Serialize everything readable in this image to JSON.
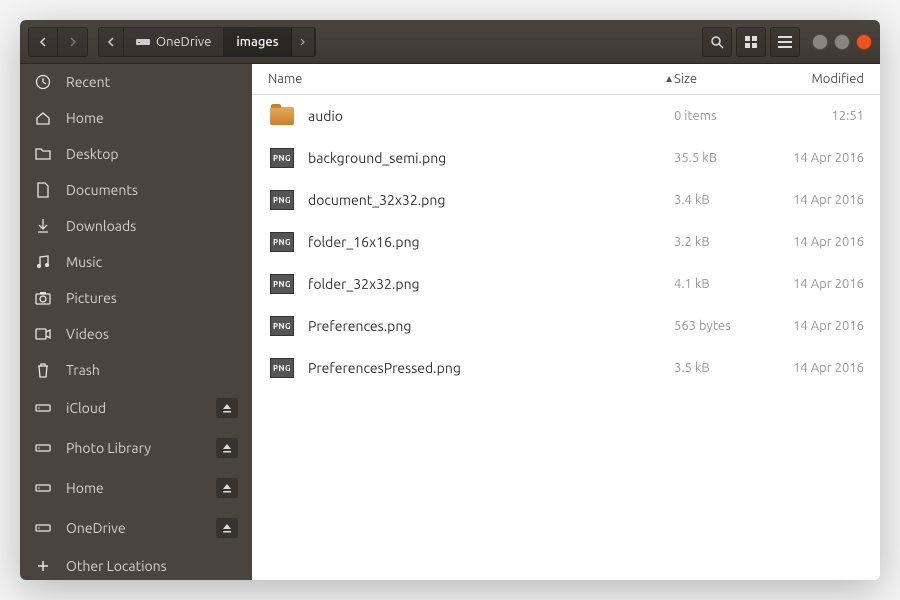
{
  "breadcrumb": {
    "parent": "OneDrive",
    "current": "images"
  },
  "sidebar": {
    "items": [
      {
        "icon": "clock",
        "label": "Recent"
      },
      {
        "icon": "home",
        "label": "Home"
      },
      {
        "icon": "folder",
        "label": "Desktop"
      },
      {
        "icon": "document",
        "label": "Documents"
      },
      {
        "icon": "download",
        "label": "Downloads"
      },
      {
        "icon": "music",
        "label": "Music"
      },
      {
        "icon": "camera",
        "label": "Pictures"
      },
      {
        "icon": "video",
        "label": "Videos"
      },
      {
        "icon": "trash",
        "label": "Trash"
      },
      {
        "icon": "drive",
        "label": "iCloud",
        "eject": true
      },
      {
        "icon": "drive",
        "label": "Photo Library",
        "eject": true
      },
      {
        "icon": "drive",
        "label": "Home",
        "eject": true
      },
      {
        "icon": "drive",
        "label": "OneDrive",
        "eject": true
      },
      {
        "icon": "plus",
        "label": "Other Locations"
      }
    ]
  },
  "columns": {
    "name": "Name",
    "size": "Size",
    "modified": "Modified"
  },
  "files": [
    {
      "type": "folder",
      "name": "audio",
      "size": "0 items",
      "modified": "12:51"
    },
    {
      "type": "png",
      "name": "background_semi.png",
      "size": "35.5 kB",
      "modified": "14 Apr 2016"
    },
    {
      "type": "png",
      "name": "document_32x32.png",
      "size": "3.4 kB",
      "modified": "14 Apr 2016"
    },
    {
      "type": "png",
      "name": "folder_16x16.png",
      "size": "3.2 kB",
      "modified": "14 Apr 2016"
    },
    {
      "type": "png",
      "name": "folder_32x32.png",
      "size": "4.1 kB",
      "modified": "14 Apr 2016"
    },
    {
      "type": "png",
      "name": "Preferences.png",
      "size": "563 bytes",
      "modified": "14 Apr 2016"
    },
    {
      "type": "png",
      "name": "PreferencesPressed.png",
      "size": "3.5 kB",
      "modified": "14 Apr 2016"
    }
  ],
  "png_badge": "PNG"
}
